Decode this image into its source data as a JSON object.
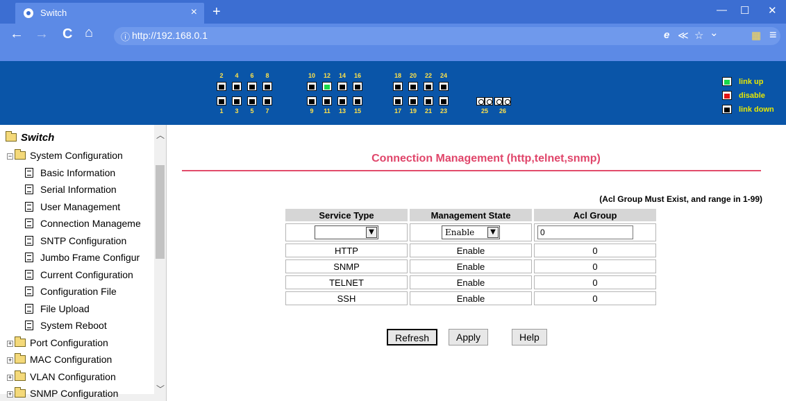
{
  "browser": {
    "tab_title": "Switch",
    "tab_close": "×",
    "new_tab": "+",
    "url_prefix": "ⓘ",
    "url": "http://192.168.0.1",
    "window_controls": {
      "minimize": "—",
      "maximize": "☐",
      "close": "✕"
    },
    "nav": {
      "back": "←",
      "forward": "→",
      "reload": "C",
      "home": "⌂"
    },
    "right_icons": {
      "ie": "e",
      "share": "≪",
      "star": "☆",
      "menu_chevron": "⌄",
      "apps": "▦",
      "hamburger": "≡"
    }
  },
  "port_panel": {
    "top_numbers": [
      "2",
      "4",
      "6",
      "8",
      "10",
      "12",
      "14",
      "16",
      "18",
      "20",
      "22",
      "24"
    ],
    "bottom_numbers": [
      "1",
      "3",
      "5",
      "7",
      "9",
      "11",
      "13",
      "15",
      "17",
      "19",
      "21",
      "23"
    ],
    "fiber_numbers": [
      "25",
      "26"
    ],
    "link_up_port": "12",
    "legend": {
      "up": "link up",
      "disable": "disable",
      "down": "link down"
    }
  },
  "sidebar": {
    "root": "Switch",
    "items": [
      {
        "label": "System Configuration",
        "type": "folder-open"
      },
      {
        "label": "Basic Information",
        "type": "doc"
      },
      {
        "label": "Serial Information",
        "type": "doc"
      },
      {
        "label": "User Management",
        "type": "doc"
      },
      {
        "label": "Connection Manageme",
        "type": "doc"
      },
      {
        "label": "SNTP Configuration",
        "type": "doc"
      },
      {
        "label": "Jumbo Frame Configur",
        "type": "doc"
      },
      {
        "label": "Current Configuration",
        "type": "doc"
      },
      {
        "label": "Configuration File",
        "type": "doc"
      },
      {
        "label": "File Upload",
        "type": "doc"
      },
      {
        "label": "System Reboot",
        "type": "doc"
      },
      {
        "label": "Port Configuration",
        "type": "folder"
      },
      {
        "label": "MAC Configuration",
        "type": "folder"
      },
      {
        "label": "VLAN Configuration",
        "type": "folder"
      },
      {
        "label": "SNMP Configuration",
        "type": "folder"
      }
    ]
  },
  "main": {
    "title": "Connection Management (http,telnet,snmp)",
    "acl_note": "(Acl Group Must Exist, and range in 1-99)",
    "headers": {
      "service": "Service Type",
      "state": "Management State",
      "acl": "Acl Group"
    },
    "input_row": {
      "service_value": "",
      "state_value": "Enable",
      "acl_value": "0"
    },
    "rows": [
      {
        "service": "HTTP",
        "state": "Enable",
        "acl": "0"
      },
      {
        "service": "SNMP",
        "state": "Enable",
        "acl": "0"
      },
      {
        "service": "TELNET",
        "state": "Enable",
        "acl": "0"
      },
      {
        "service": "SSH",
        "state": "Enable",
        "acl": "0"
      }
    ],
    "buttons": {
      "refresh": "Refresh",
      "apply": "Apply",
      "help": "Help"
    }
  },
  "colors": {
    "title_pink": "#e0456a",
    "panel_blue": "#0a55a8",
    "chrome_blue": "#3c6ed2"
  }
}
